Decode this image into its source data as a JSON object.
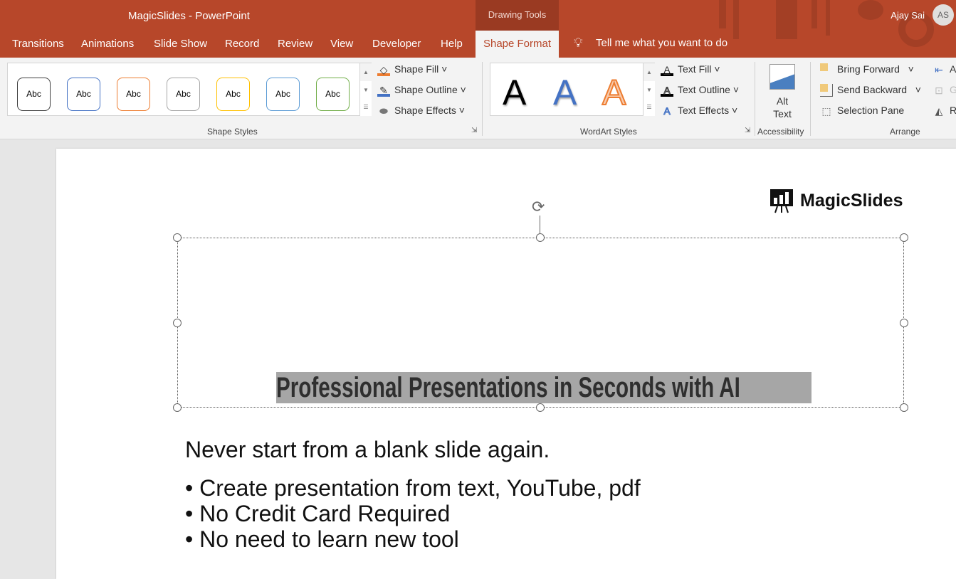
{
  "window": {
    "title": "MagicSlides  -  PowerPoint",
    "context_tab_group": "Drawing Tools",
    "user_name": "Ajay Sai",
    "user_initials": "AS"
  },
  "tabs": [
    "Transitions",
    "Animations",
    "Slide Show",
    "Record",
    "Review",
    "View",
    "Developer",
    "Help"
  ],
  "active_tab": "Shape Format",
  "tell_me": "Tell me what you want to do",
  "shape_styles": {
    "sample": "Abc",
    "label": "Shape Styles",
    "fill": "Shape Fill",
    "outline": "Shape Outline",
    "effects": "Shape Effects",
    "colors": [
      "#404040",
      "#4472c4",
      "#ed7d31",
      "#a5a5a5",
      "#ffc000",
      "#5b9bd5",
      "#70ad47"
    ]
  },
  "wordart": {
    "sample": "A",
    "label": "WordArt Styles",
    "text_fill": "Text Fill",
    "text_outline": "Text Outline",
    "text_effects": "Text Effects"
  },
  "accessibility": {
    "alt_text_1": "Alt",
    "alt_text_2": "Text",
    "label": "Accessibility"
  },
  "arrange": {
    "bring_forward": "Bring Forward",
    "send_backward": "Send Backward",
    "selection_pane": "Selection Pane",
    "align": "A",
    "group": "G",
    "rotate": "R",
    "label": "Arrange"
  },
  "slide": {
    "logo": "MagicSlides",
    "title": "Professional Presentations in Seconds with AI",
    "subtitle": "Never start from a blank slide again.",
    "bullets": [
      "• Create presentation from text, YouTube, pdf",
      "• No Credit Card Required",
      "• No need to learn new tool"
    ]
  }
}
